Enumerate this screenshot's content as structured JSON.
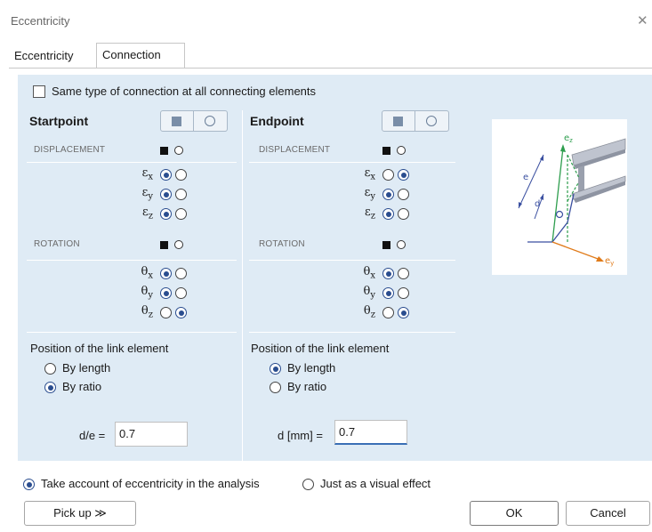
{
  "window": {
    "title": "Eccentricity",
    "close_glyph": "✕"
  },
  "tabs": [
    {
      "label": "Eccentricity"
    },
    {
      "label": "Connection"
    }
  ],
  "same_type_label": "Same type of connection at all connecting elements",
  "startpoint": {
    "heading": "Startpoint",
    "displacement_label": "DISPLACEMENT",
    "rotation_label": "ROTATION",
    "disp_rows": [
      {
        "sym": "ε",
        "sub": "x",
        "selected": 0
      },
      {
        "sym": "ε",
        "sub": "y",
        "selected": 0
      },
      {
        "sym": "ε",
        "sub": "z",
        "selected": 0
      }
    ],
    "rot_rows": [
      {
        "sym": "θ",
        "sub": "x",
        "selected": 0
      },
      {
        "sym": "θ",
        "sub": "y",
        "selected": 0
      },
      {
        "sym": "θ",
        "sub": "z",
        "selected": 1
      }
    ],
    "position_heading": "Position of the link element",
    "opt_length": "By length",
    "opt_ratio": "By ratio",
    "selected_option": "ratio",
    "input_label": "d/e =",
    "input_value": "0.7"
  },
  "endpoint": {
    "heading": "Endpoint",
    "displacement_label": "DISPLACEMENT",
    "rotation_label": "ROTATION",
    "disp_rows": [
      {
        "sym": "ε",
        "sub": "x",
        "selected": 1
      },
      {
        "sym": "ε",
        "sub": "y",
        "selected": 0
      },
      {
        "sym": "ε",
        "sub": "z",
        "selected": 0
      }
    ],
    "rot_rows": [
      {
        "sym": "θ",
        "sub": "x",
        "selected": 0
      },
      {
        "sym": "θ",
        "sub": "y",
        "selected": 0
      },
      {
        "sym": "θ",
        "sub": "z",
        "selected": 1
      }
    ],
    "position_heading": "Position of the link element",
    "opt_length": "By length",
    "opt_ratio": "By ratio",
    "selected_option": "length",
    "input_label": "d [mm] =",
    "input_value": "0.7"
  },
  "diagram": {
    "labels": {
      "ez": "e",
      "ez_sub": "z",
      "ey": "e",
      "ey_sub": "y",
      "e": "e",
      "d": "d"
    }
  },
  "analysis": {
    "opt_account": "Take account of eccentricity in the analysis",
    "opt_visual": "Just as a visual effect",
    "selected": "account"
  },
  "buttons": {
    "pickup": "Pick up ≫",
    "ok": "OK",
    "cancel": "Cancel"
  },
  "colors": {
    "panel": "#dfebf5",
    "radio_accent": "#2a4d8f",
    "arrow_green": "#2e9e4e",
    "arrow_orange": "#e07b1a",
    "arrow_blue": "#3a4fa0"
  }
}
